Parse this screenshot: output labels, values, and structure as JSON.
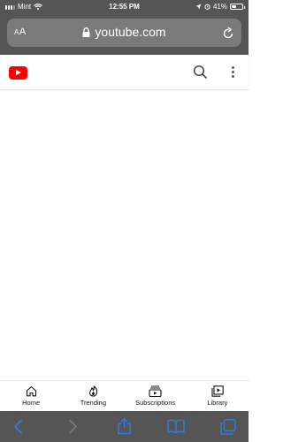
{
  "status_bar": {
    "carrier": "Mint",
    "time": "12:55 PM",
    "battery_percent": "41%",
    "battery_level": 0.41
  },
  "browser": {
    "text_size_label": "AA",
    "url": "youtube.com"
  },
  "youtube_header": {
    "logo_icon": "youtube-logo-icon",
    "search_icon": "search-icon",
    "menu_icon": "more-vertical-icon"
  },
  "bottom_nav": {
    "items": [
      {
        "label": "Home",
        "icon": "home-icon"
      },
      {
        "label": "Trending",
        "icon": "flame-icon"
      },
      {
        "label": "Subscriptions",
        "icon": "subscriptions-icon"
      },
      {
        "label": "Library",
        "icon": "library-icon"
      }
    ]
  },
  "safari_toolbar": {
    "icons": [
      "back-arrow-icon",
      "forward-arrow-icon",
      "share-icon",
      "bookmarks-icon",
      "tabs-icon"
    ]
  },
  "colors": {
    "chrome": "#555555",
    "url_bar": "#7a7a7a",
    "youtube_red": "#ff0000",
    "safari_blue": "#2f7de1"
  }
}
